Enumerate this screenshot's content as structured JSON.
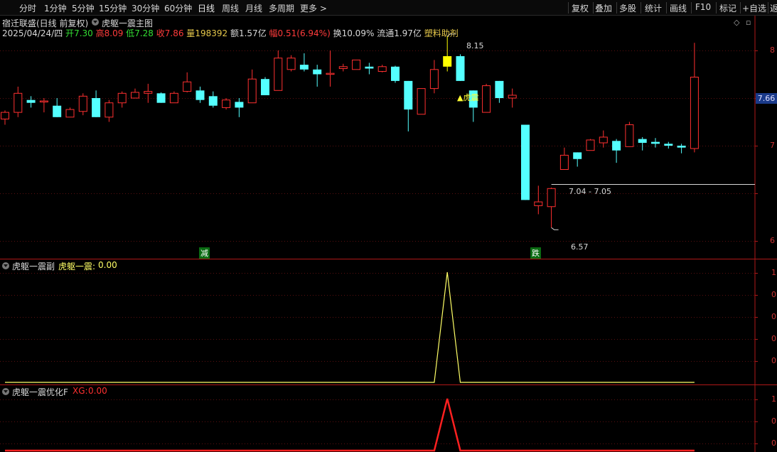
{
  "toolbar": {
    "left": [
      "分时",
      "1分钟",
      "5分钟",
      "15分钟",
      "30分钟",
      "60分钟",
      "日线",
      "周线",
      "月线",
      "多周期",
      "更多 >"
    ],
    "right": [
      "复权",
      "叠加",
      "多股",
      "统计",
      "画线",
      "F10",
      "标记",
      "+自选",
      "返"
    ]
  },
  "header": {
    "title": "宿迁联盛(日线 前复权)",
    "indicator": "虎躯一震主图",
    "date": "2025/04/24/四",
    "open_label": "开",
    "open": "7.30",
    "high_label": "高",
    "high": "8.09",
    "low_label": "低",
    "low": "7.28",
    "close_label": "收",
    "close": "7.86",
    "vol_label": "量",
    "vol": "198392",
    "amt_label": "额",
    "amt": "1.57亿",
    "chg_label": "幅",
    "chg": "0.51(6.94%)",
    "turn_label": "换",
    "turn": "10.09%",
    "float_label": "流通",
    "float": "1.97亿",
    "sector": "塑料助剂"
  },
  "main_chart": {
    "annotations": {
      "high_mark": "8.15",
      "low_mark": "6.57",
      "range_mark": "7.04 - 7.05",
      "signal_label": "▲虎震",
      "left_marker": "减",
      "right_marker": "跌"
    },
    "current_price": "7.66",
    "axis_labels": [
      "8",
      "7",
      "6"
    ]
  },
  "sub1": {
    "name": "虎躯一震副",
    "series_label": "虎躯一震:",
    "series_value": "0.00",
    "axis_labels": [
      "1",
      "0",
      "0",
      "0",
      "0"
    ]
  },
  "sub2": {
    "name": "虎躯一震优化F",
    "series_label": "XG:",
    "series_value": "0.00",
    "axis_labels": [
      "1",
      "0",
      "0"
    ]
  },
  "chart_data": {
    "type": "candlestick",
    "colors": {
      "up": "#ff3030",
      "down": "#54ffff",
      "signal": "#ffff00",
      "sub1_line": "#ffff66",
      "sub2_line": "#ff2020"
    },
    "candles": [
      {
        "o": 7.28,
        "c": 7.35,
        "h": 7.37,
        "l": 7.22
      },
      {
        "o": 7.35,
        "c": 7.55,
        "h": 7.62,
        "l": 7.3
      },
      {
        "o": 7.48,
        "c": 7.45,
        "h": 7.52,
        "l": 7.4
      },
      {
        "o": 7.46,
        "c": 7.47,
        "h": 7.5,
        "l": 7.35
      },
      {
        "o": 7.42,
        "c": 7.3,
        "h": 7.5,
        "l": 7.3
      },
      {
        "o": 7.3,
        "c": 7.38,
        "h": 7.4,
        "l": 7.3
      },
      {
        "o": 7.36,
        "c": 7.52,
        "h": 7.55,
        "l": 7.32
      },
      {
        "o": 7.5,
        "c": 7.3,
        "h": 7.58,
        "l": 7.3
      },
      {
        "o": 7.3,
        "c": 7.45,
        "h": 7.48,
        "l": 7.25
      },
      {
        "o": 7.45,
        "c": 7.55,
        "h": 7.57,
        "l": 7.4
      },
      {
        "o": 7.5,
        "c": 7.56,
        "h": 7.6,
        "l": 7.5
      },
      {
        "o": 7.55,
        "c": 7.57,
        "h": 7.65,
        "l": 7.45
      },
      {
        "o": 7.55,
        "c": 7.45,
        "h": 7.56,
        "l": 7.45
      },
      {
        "o": 7.45,
        "c": 7.55,
        "h": 7.57,
        "l": 7.45
      },
      {
        "o": 7.57,
        "c": 7.67,
        "h": 7.77,
        "l": 7.56
      },
      {
        "o": 7.58,
        "c": 7.48,
        "h": 7.62,
        "l": 7.45
      },
      {
        "o": 7.52,
        "c": 7.42,
        "h": 7.57,
        "l": 7.4
      },
      {
        "o": 7.4,
        "c": 7.48,
        "h": 7.5,
        "l": 7.38
      },
      {
        "o": 7.46,
        "c": 7.4,
        "h": 7.5,
        "l": 7.3
      },
      {
        "o": 7.45,
        "c": 7.7,
        "h": 7.8,
        "l": 7.45
      },
      {
        "o": 7.7,
        "c": 7.53,
        "h": 7.72,
        "l": 7.53
      },
      {
        "o": 7.58,
        "c": 7.92,
        "h": 8.0,
        "l": 7.58
      },
      {
        "o": 7.8,
        "c": 7.92,
        "h": 7.95,
        "l": 7.78
      },
      {
        "o": 7.85,
        "c": 7.8,
        "h": 7.97,
        "l": 7.78
      },
      {
        "o": 7.8,
        "c": 7.75,
        "h": 7.85,
        "l": 7.62
      },
      {
        "o": 7.75,
        "c": 7.76,
        "h": 8.0,
        "l": 7.62
      },
      {
        "o": 7.81,
        "c": 7.83,
        "h": 7.86,
        "l": 7.78
      },
      {
        "o": 7.8,
        "c": 7.9,
        "h": 7.9,
        "l": 7.8
      },
      {
        "o": 7.83,
        "c": 7.81,
        "h": 7.87,
        "l": 7.75
      },
      {
        "o": 7.78,
        "c": 7.83,
        "h": 7.85,
        "l": 7.77
      },
      {
        "o": 7.83,
        "c": 7.68,
        "h": 7.84,
        "l": 7.66
      },
      {
        "o": 7.68,
        "c": 7.38,
        "h": 7.68,
        "l": 7.15
      },
      {
        "o": 7.33,
        "c": 7.6,
        "h": 7.6,
        "l": 7.33
      },
      {
        "o": 7.6,
        "c": 7.8,
        "h": 7.9,
        "l": 7.55
      },
      {
        "o": 7.94,
        "c": 7.83,
        "h": 8.15,
        "l": 7.78,
        "signal": true
      },
      {
        "o": 7.94,
        "c": 7.68,
        "h": 7.96,
        "l": 7.68
      },
      {
        "o": 7.58,
        "c": 7.4,
        "h": 7.58,
        "l": 7.25
      },
      {
        "o": 7.35,
        "c": 7.63,
        "h": 7.65,
        "l": 7.35
      },
      {
        "o": 7.68,
        "c": 7.5,
        "h": 7.68,
        "l": 7.45
      },
      {
        "o": 7.5,
        "c": 7.53,
        "h": 7.6,
        "l": 7.4
      },
      {
        "o": 7.22,
        "c": 6.43,
        "h": 7.22,
        "l": 6.43
      },
      {
        "o": 6.37,
        "c": 6.41,
        "h": 6.58,
        "l": 6.28
      },
      {
        "o": 6.36,
        "c": 6.55,
        "h": 6.56,
        "l": 6.14
      },
      {
        "o": 6.75,
        "c": 6.9,
        "h": 6.98,
        "l": 6.75
      },
      {
        "o": 6.93,
        "c": 6.86,
        "h": 6.93,
        "l": 6.78
      },
      {
        "o": 6.95,
        "c": 7.06,
        "h": 7.07,
        "l": 6.95
      },
      {
        "o": 7.03,
        "c": 7.09,
        "h": 7.16,
        "l": 6.98
      },
      {
        "o": 7.05,
        "c": 6.95,
        "h": 7.07,
        "l": 6.82
      },
      {
        "o": 6.99,
        "c": 7.22,
        "h": 7.25,
        "l": 6.99
      },
      {
        "o": 7.07,
        "c": 7.03,
        "h": 7.09,
        "l": 6.95
      },
      {
        "o": 7.04,
        "c": 7.02,
        "h": 7.08,
        "l": 6.98
      },
      {
        "o": 7.02,
        "c": 7.0,
        "h": 7.04,
        "l": 6.97
      },
      {
        "o": 7.0,
        "c": 6.98,
        "h": 7.02,
        "l": 6.92
      },
      {
        "o": 6.97,
        "c": 7.72,
        "h": 8.08,
        "l": 6.93
      }
    ],
    "sub1_series": [
      0,
      0,
      0,
      0,
      0,
      0,
      0,
      0,
      0,
      0,
      0,
      0,
      0,
      0,
      0,
      0,
      0,
      0,
      0,
      0,
      0,
      0,
      0,
      0,
      0,
      0,
      0,
      0,
      0,
      0,
      0,
      0,
      0,
      0,
      1,
      0,
      0,
      0,
      0,
      0,
      0,
      0,
      0,
      0,
      0,
      0,
      0,
      0,
      0,
      0,
      0,
      0,
      0,
      0
    ],
    "sub2_series": [
      0,
      0,
      0,
      0,
      0,
      0,
      0,
      0,
      0,
      0,
      0,
      0,
      0,
      0,
      0,
      0,
      0,
      0,
      0,
      0,
      0,
      0,
      0,
      0,
      0,
      0,
      0,
      0,
      0,
      0,
      0,
      0,
      0,
      0,
      1,
      0,
      0,
      0,
      0,
      0,
      0,
      0,
      0,
      0,
      0,
      0,
      0,
      0,
      0,
      0,
      0,
      0,
      0,
      0
    ]
  }
}
